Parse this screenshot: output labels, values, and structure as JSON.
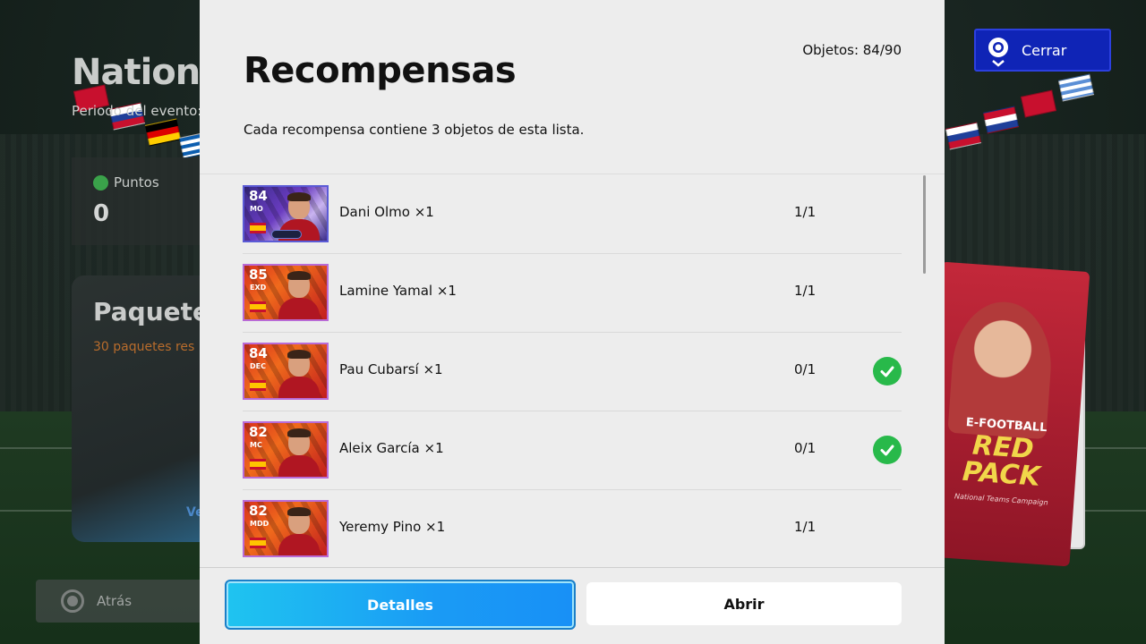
{
  "background": {
    "title": "Nationa",
    "period_label": "Periodo del evento:",
    "points_label": "Puntos",
    "points_value": "0",
    "pack_title": "Paquete",
    "pack_subtitle": "30 paquetes res",
    "pack_link": "Ve",
    "back_label": "Atrás",
    "pack_art": {
      "brand": "E-FOOTBALL",
      "name": "RED PACK",
      "campaign": "National Teams Campaign"
    }
  },
  "close_button": {
    "label": "Cerrar",
    "icon": "close-pin-icon"
  },
  "modal": {
    "title": "Recompensas",
    "objects_count": "Objetos: 84/90",
    "description": "Cada recompensa contiene 3 objetos de esta lista.",
    "rewards": [
      {
        "rating": "84",
        "position": "MO",
        "name": "Dani Olmo ×1",
        "count": "1/1",
        "checked": false,
        "card_style": "purple"
      },
      {
        "rating": "85",
        "position": "EXD",
        "name": "Lamine Yamal ×1",
        "count": "1/1",
        "checked": false,
        "card_style": "red"
      },
      {
        "rating": "84",
        "position": "DEC",
        "name": "Pau Cubarsí ×1",
        "count": "0/1",
        "checked": true,
        "card_style": "red"
      },
      {
        "rating": "82",
        "position": "MC",
        "name": "Aleix García ×1",
        "count": "0/1",
        "checked": true,
        "card_style": "red"
      },
      {
        "rating": "82",
        "position": "MDD",
        "name": "Yeremy Pino ×1",
        "count": "1/1",
        "checked": false,
        "card_style": "red"
      }
    ],
    "details_button": "Detalles",
    "open_button": "Abrir"
  },
  "colors": {
    "close_button": "#0f24b6",
    "details_button": "#1a9bf5",
    "check": "#28b94a"
  }
}
